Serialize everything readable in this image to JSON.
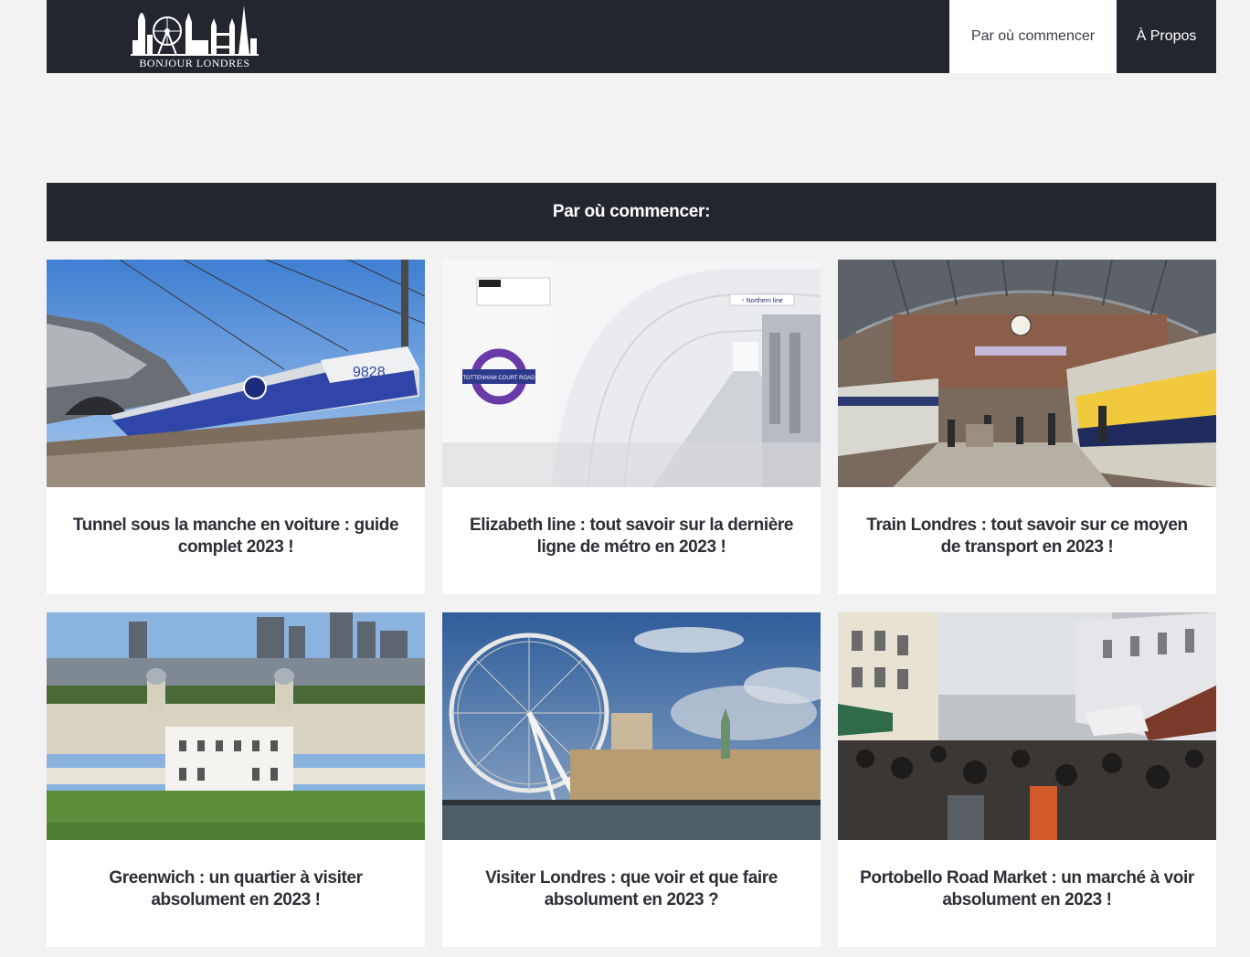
{
  "header": {
    "logo_text": "BONJOUR LONDRES",
    "nav": [
      {
        "label": "Par où commencer"
      },
      {
        "label": "À Propos"
      }
    ]
  },
  "section": {
    "title": "Par où commencer:"
  },
  "cards": [
    {
      "title": "Tunnel sous la manche en voiture : guide complet 2023 !"
    },
    {
      "title": "Elizabeth line : tout savoir sur la dernière ligne de métro en 2023 !"
    },
    {
      "title": "Train Londres : tout savoir sur ce moyen de transport en 2023 !"
    },
    {
      "title": "Greenwich : un quartier à visiter absolument en 2023 !"
    },
    {
      "title": "Visiter Londres : que voir et que faire absolument en 2023 ?"
    },
    {
      "title": "Portobello Road Market : un marché à voir absolument en 2023 !"
    }
  ],
  "colors": {
    "header_bg": "#23262e",
    "page_bg": "#f2f2f2",
    "card_bg": "#ffffff",
    "title_text": "#2c2f36"
  }
}
